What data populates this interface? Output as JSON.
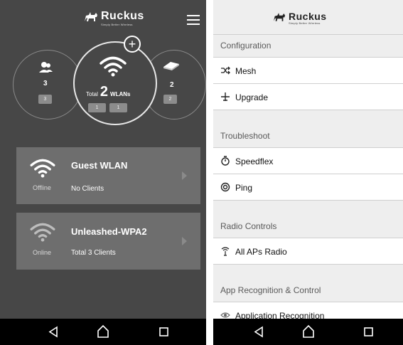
{
  "left_screen": {
    "brand": {
      "name": "Ruckus",
      "tagline": "Simply Better Wireless"
    },
    "overview": {
      "clients": {
        "count": "3",
        "badge": "3"
      },
      "wlans": {
        "total_label": "Total",
        "count": "2",
        "unit": "WLANs",
        "badges": [
          "1",
          "1"
        ]
      },
      "aps": {
        "count": "2",
        "badge": "2"
      }
    },
    "networks": [
      {
        "name": "Guest WLAN",
        "status": "Offline",
        "clients": "No Clients"
      },
      {
        "name": "Unleashed-WPA2",
        "status": "Online",
        "clients": "Total 3 Clients"
      }
    ]
  },
  "right_screen": {
    "brand": {
      "name": "Ruckus",
      "tagline": "Simply Better Wireless"
    },
    "sections": [
      {
        "title": "Configuration",
        "items": [
          {
            "label": "Mesh",
            "icon": "shuffle-icon"
          },
          {
            "label": "Upgrade",
            "icon": "airplane-icon"
          }
        ]
      },
      {
        "title": "Troubleshoot",
        "items": [
          {
            "label": "Speedflex",
            "icon": "stopwatch-icon"
          },
          {
            "label": "Ping",
            "icon": "ping-icon"
          }
        ]
      },
      {
        "title": "Radio Controls",
        "items": [
          {
            "label": "All APs Radio",
            "icon": "antenna-icon"
          }
        ]
      },
      {
        "title": "App Recognition & Control",
        "items": [
          {
            "label": "Application Recognition",
            "icon": "eye-icon"
          }
        ]
      }
    ]
  },
  "navigation": {
    "buttons": [
      "back",
      "home",
      "recents"
    ]
  },
  "colors": {
    "dark_bg": "#474747",
    "card_bg": "#6e6e6e",
    "section_bg": "#eeeeee",
    "navbar": "#000000"
  }
}
